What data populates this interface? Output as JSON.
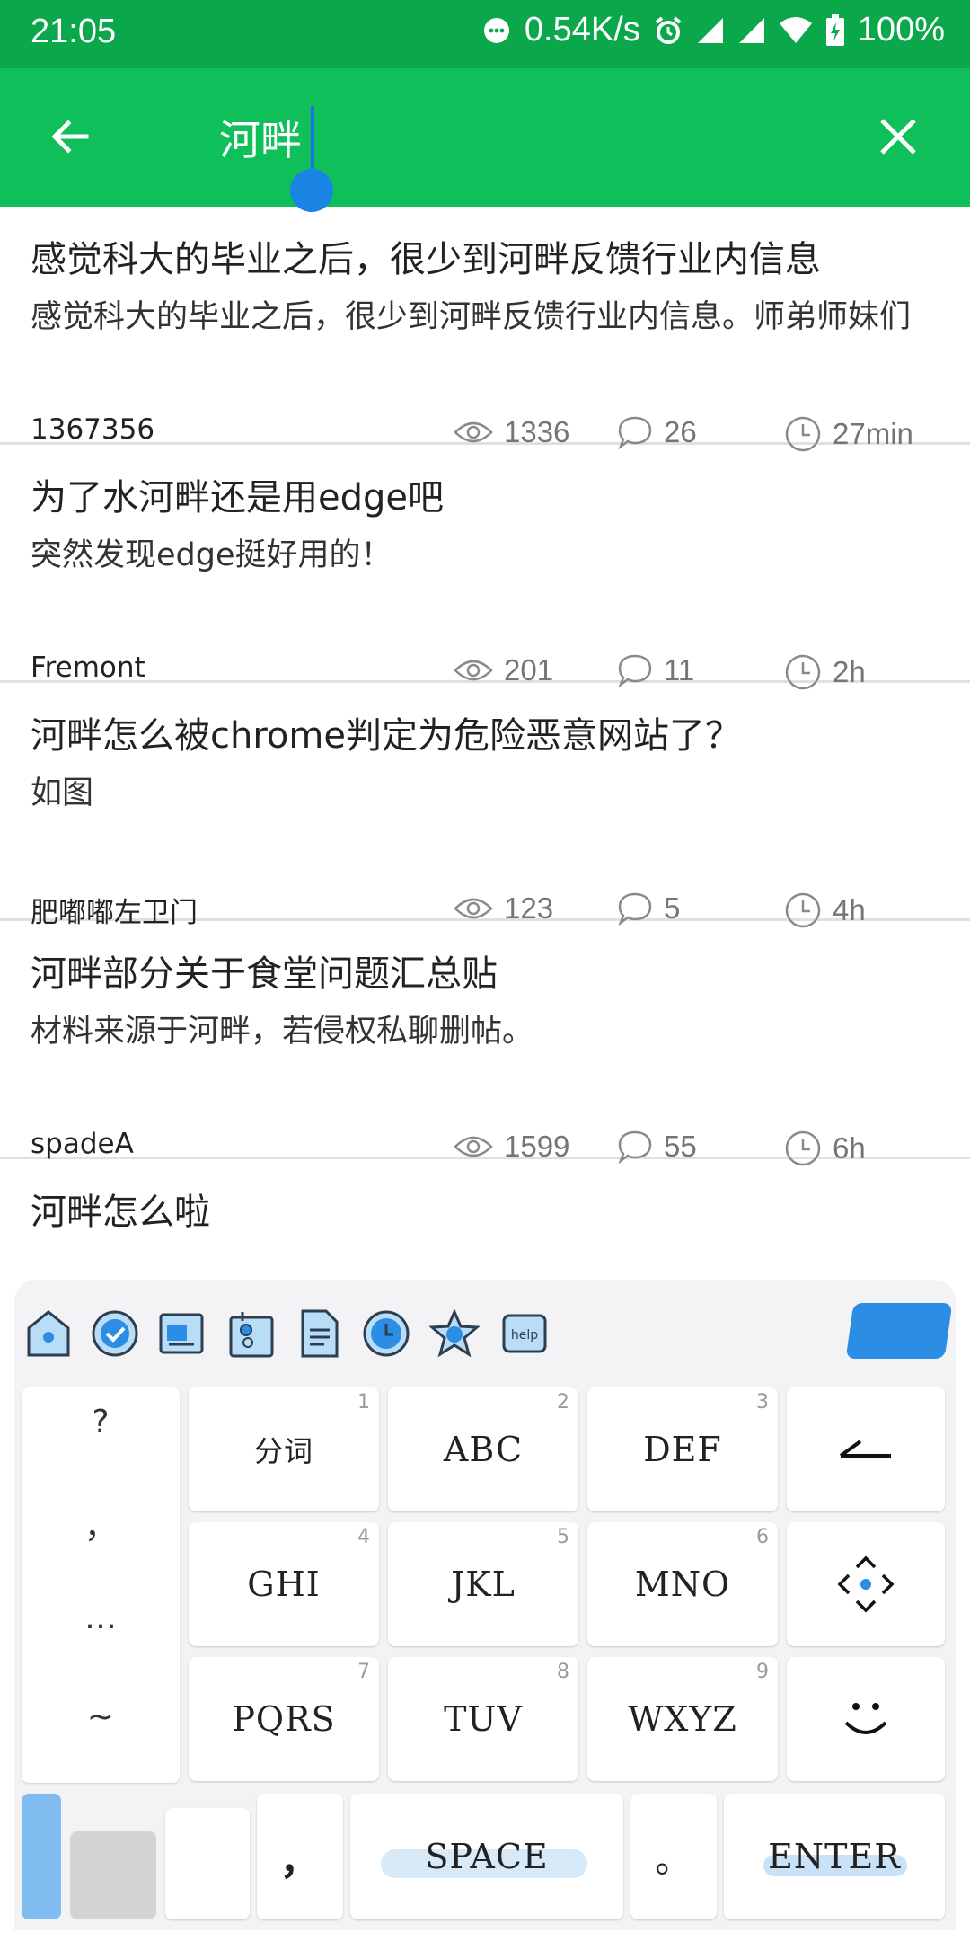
{
  "status_bar": {
    "time": "21:05",
    "network_speed": "0.54K/s",
    "battery": "100%",
    "icons": [
      "chat-bubble-icon",
      "alarm-icon",
      "signal-icon",
      "signal-icon",
      "wifi-icon",
      "battery-icon"
    ]
  },
  "search": {
    "value": "河畔",
    "back_icon": "arrow-left-icon",
    "clear_icon": "close-icon"
  },
  "posts": [
    {
      "title": "感觉科大的毕业之后，很少到河畔反馈行业内信息",
      "summary": "感觉科大的毕业之后，很少到河畔反馈行业内信息。师弟师妹们",
      "author": "1367356",
      "views": "1336",
      "comments": "26",
      "time": "27min"
    },
    {
      "title": "为了水河畔还是用edge吧",
      "summary": "突然发现edge挺好用的！",
      "author": "Fremont",
      "views": "201",
      "comments": "11",
      "time": "2h"
    },
    {
      "title": "河畔怎么被chrome判定为危险恶意网站了？",
      "summary": "如图",
      "author": "肥嘟嘟左卫门",
      "views": "123",
      "comments": "5",
      "time": "4h"
    },
    {
      "title": "河畔部分关于食堂问题汇总贴",
      "summary": "材料来源于河畔，若侵权私聊删帖。",
      "author": "spadeA",
      "views": "1599",
      "comments": "55",
      "time": "6h"
    },
    {
      "title": "河畔怎么啦"
    }
  ],
  "keyboard": {
    "toolbar_icons": [
      "home-icon",
      "check-icon",
      "keyboard-icon",
      "clipboard-icon",
      "document-icon",
      "clock-icon",
      "star-icon",
      "help-icon"
    ],
    "help_label": "help",
    "side_symbols": [
      "?",
      "，",
      "…",
      "~"
    ],
    "keys": [
      {
        "label": "分词",
        "num": "1"
      },
      {
        "label": "ABC",
        "num": "2"
      },
      {
        "label": "DEF",
        "num": "3"
      },
      {
        "label": "GHI",
        "num": "4"
      },
      {
        "label": "JKL",
        "num": "5"
      },
      {
        "label": "MNO",
        "num": "6"
      },
      {
        "label": "PQRS",
        "num": "7"
      },
      {
        "label": "TUV",
        "num": "8"
      },
      {
        "label": "WXYZ",
        "num": "9"
      }
    ],
    "comma": "，",
    "space": "SPACE",
    "period": "。",
    "enter": "ENTER",
    "colors": {
      "accent": "#2b8de4",
      "header": "#0ebf5a",
      "status": "#0aa84a"
    }
  }
}
